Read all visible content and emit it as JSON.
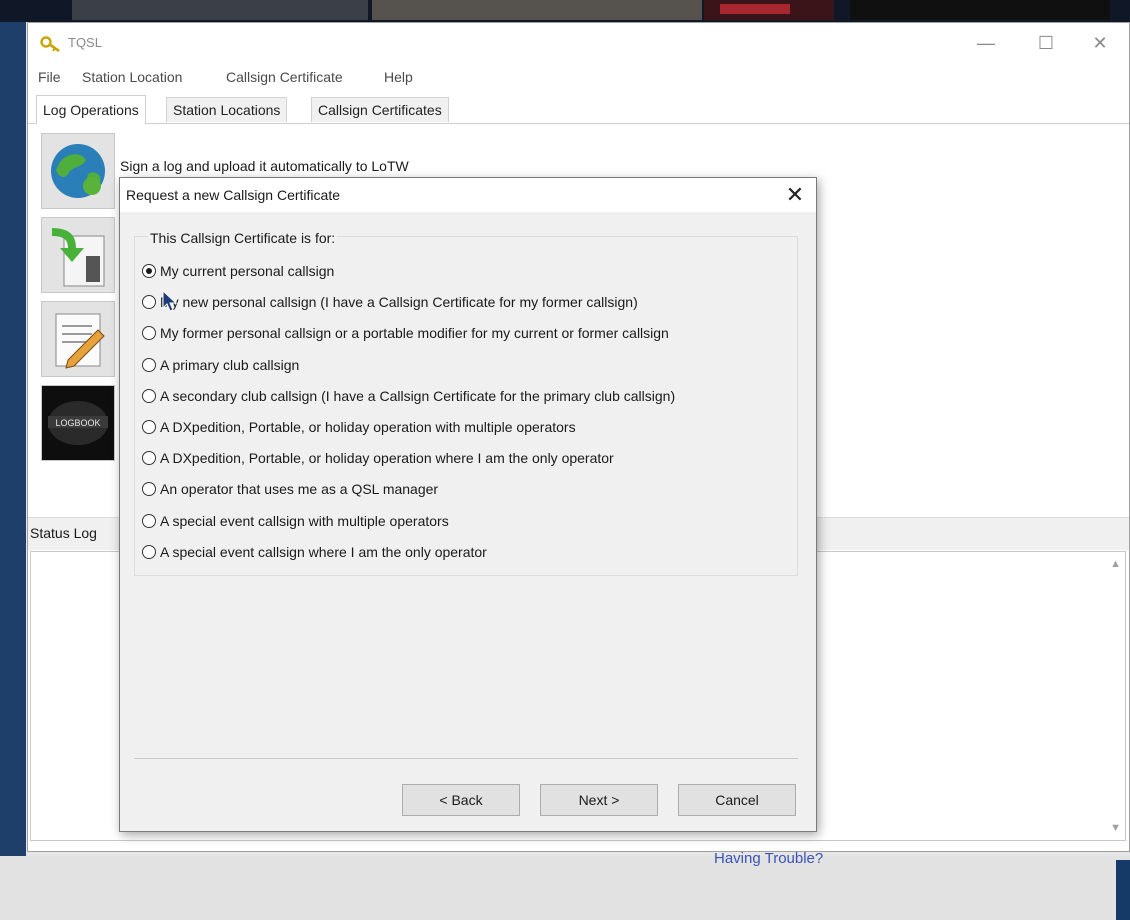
{
  "app": {
    "title": "TQSL"
  },
  "menu": [
    "File",
    "Station Location",
    "Callsign Certificate",
    "Help"
  ],
  "tabs": [
    "Log Operations",
    "Station Locations",
    "Callsign Certificates"
  ],
  "operations": {
    "sign_upload_label": "Sign a log and upload it automatically to LoTW"
  },
  "status": {
    "label": "Status Log"
  },
  "footer": {
    "trouble_link": "Having Trouble?"
  },
  "dialog": {
    "title": "Request a new Callsign Certificate",
    "group_label": "This Callsign Certificate is for:",
    "options": [
      {
        "label": "My current personal callsign",
        "checked": true
      },
      {
        "label": "My new personal callsign (I have a Callsign Certificate for my former callsign)",
        "checked": false
      },
      {
        "label": "My former personal callsign or a portable modifier for my current or former callsign",
        "checked": false
      },
      {
        "label": "A primary club callsign",
        "checked": false
      },
      {
        "label": "A secondary club callsign (I have a Callsign Certificate for the primary club callsign)",
        "checked": false
      },
      {
        "label": "A DXpedition, Portable, or holiday operation with multiple operators",
        "checked": false
      },
      {
        "label": "A DXpedition, Portable, or holiday operation where I am the only operator",
        "checked": false
      },
      {
        "label": "An operator that uses me as a QSL manager",
        "checked": false
      },
      {
        "label": "A special event callsign with multiple operators",
        "checked": false
      },
      {
        "label": "A special event callsign where I am the only operator",
        "checked": false
      }
    ],
    "buttons": {
      "back": "< Back",
      "next": "Next >",
      "cancel": "Cancel"
    }
  }
}
